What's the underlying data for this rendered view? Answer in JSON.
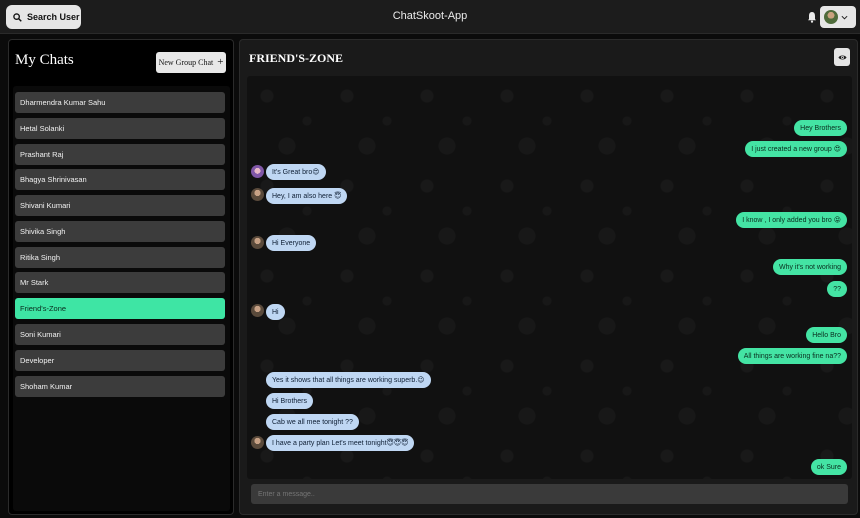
{
  "header": {
    "search_label": "Search User",
    "app_title": "ChatSkoot-App"
  },
  "sidebar": {
    "title": "My Chats",
    "new_group_label": "New Group Chat",
    "chats": [
      {
        "name": "Dharmendra Kumar Sahu"
      },
      {
        "name": "Hetal Solanki"
      },
      {
        "name": "Prashant Raj"
      },
      {
        "name": "Bhagya Shrinivasan"
      },
      {
        "name": "Shivani Kumari"
      },
      {
        "name": "Shivika Singh"
      },
      {
        "name": "Ritika Singh"
      },
      {
        "name": "Mr Stark"
      },
      {
        "name": "Friend's-Zone",
        "active": true
      },
      {
        "name": "Soni Kumari"
      },
      {
        "name": "Developer"
      },
      {
        "name": "Shoham Kumar"
      }
    ]
  },
  "chat": {
    "title": "FRIEND'S-ZONE",
    "messages": [
      {
        "text": "Hey Brothers",
        "from": "me"
      },
      {
        "text": "I just created a new group 😍",
        "from": "me"
      },
      {
        "text": "It's Great bro😍",
        "from": "them"
      },
      {
        "text": "Hey, I am also here 😇",
        "from": "them"
      },
      {
        "text": "I know , I only added you bro 😝",
        "from": "me"
      },
      {
        "text": "Hi Everyone",
        "from": "them"
      },
      {
        "text": "Why it's not working",
        "from": "me"
      },
      {
        "text": "??",
        "from": "me"
      },
      {
        "text": "Hi",
        "from": "them"
      },
      {
        "text": "Hello Bro",
        "from": "me"
      },
      {
        "text": "All things are working fine na??",
        "from": "me"
      },
      {
        "text": "Yes it shows that all things are working superb.😉",
        "from": "them"
      },
      {
        "text": "Hi Brothers",
        "from": "them"
      },
      {
        "text": "Cab we all mee tonight ??",
        "from": "them"
      },
      {
        "text": "I have a party plan Let's meet tonight😇😇😇",
        "from": "them"
      },
      {
        "text": "ok Sure",
        "from": "me"
      }
    ],
    "input_placeholder": "Enter a message.."
  },
  "colors": {
    "accent": "#3ee5a4",
    "incoming_bubble": "#bfd7f3",
    "outgoing_bubble": "#44e4a4"
  }
}
